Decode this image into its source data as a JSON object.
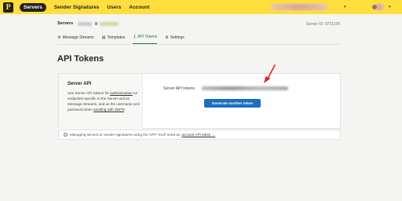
{
  "nav": {
    "logo": "P",
    "items": [
      "Servers",
      "Sender Signatures",
      "Users",
      "Account"
    ]
  },
  "breadcrumb": {
    "root": "Servers"
  },
  "server_id": {
    "label": "Server ID:",
    "value": "9721105"
  },
  "tabs": [
    {
      "icon": "⚙",
      "label": "Message Streams"
    },
    {
      "icon": "▤",
      "label": "Templates"
    },
    {
      "icon": "🔑",
      "label": "API Tokens"
    },
    {
      "icon": "⚙",
      "label": "Settings"
    }
  ],
  "page_title": "API Tokens",
  "card": {
    "title": "Server API",
    "desc_1": "Use Server API tokens for",
    "desc_link_1": "authentication",
    "desc_2": "on endpoints specific to the Server and its Message Streams, and as the username and password when",
    "desc_link_2": "sending with SMTP",
    "token_label": "Server API tokens",
    "generate_button": "Generate another token"
  },
  "info": {
    "text": "Managing servers or sender signatures using the API? You'll need an",
    "link": "account API token →"
  },
  "colors": {
    "nav_bg": "#ffde3d",
    "accent_green": "#1f7a4f",
    "button_blue": "#1c6fbf",
    "arrow_red": "#e0261a"
  }
}
